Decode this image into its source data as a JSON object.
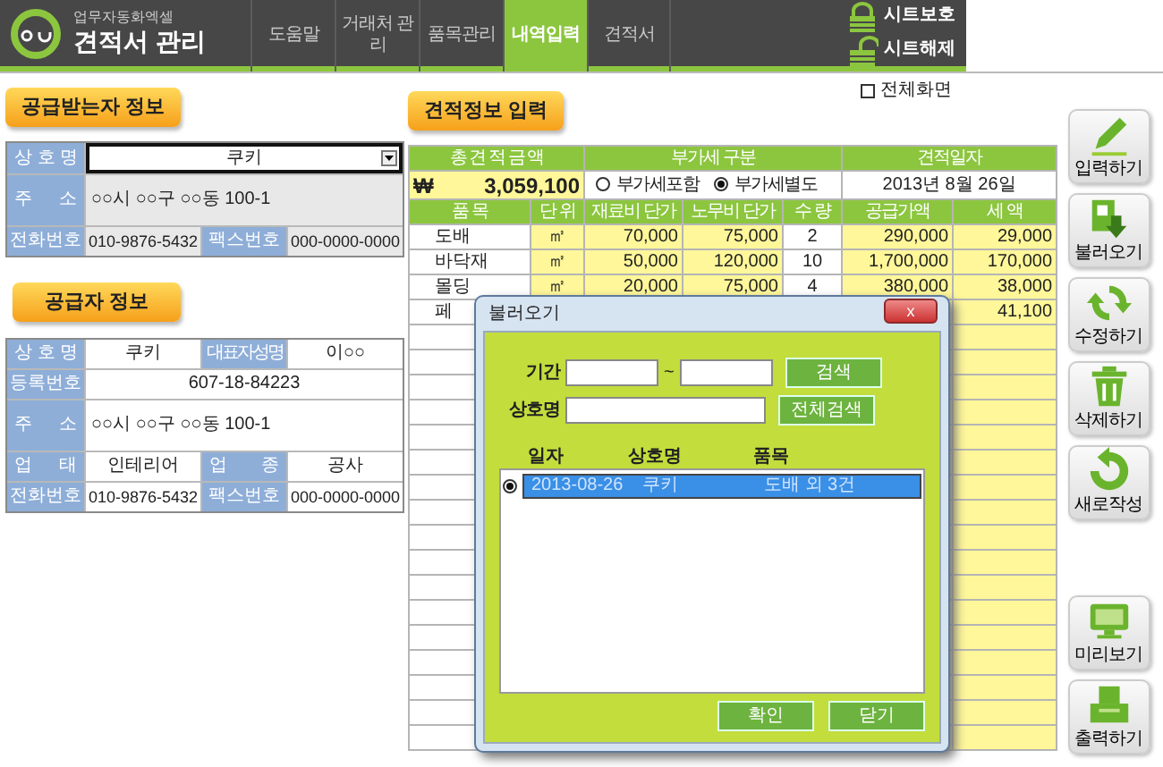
{
  "header": {
    "subtitle": "업무자동화엑셀",
    "title": "견적서 관리",
    "tabs": [
      {
        "label": "도움말",
        "selected": false
      },
      {
        "label": "거래처 관리",
        "selected": false
      },
      {
        "label": "품목관리",
        "selected": false
      },
      {
        "label": "내역입력",
        "selected": true
      },
      {
        "label": "견적서",
        "selected": false
      }
    ],
    "sheet_buttons": [
      {
        "label": "시트보호",
        "kind": "lock"
      },
      {
        "label": "시트해제",
        "kind": "unlock"
      }
    ]
  },
  "fullscreen": {
    "label": "전체화면",
    "checked": false
  },
  "recipient": {
    "title": "공급받는자 정보",
    "company_label": "상 호 명",
    "company": "쿠키",
    "address_label": "주 소",
    "address": "○○시 ○○구 ○○동 100-1",
    "phone_label": "전화번호",
    "phone": "010-9876-5432",
    "fax_label": "팩스번호",
    "fax": "000-0000-0000"
  },
  "supplier": {
    "title": "공급자 정보",
    "company_label": "상 호 명",
    "company": "쿠키",
    "rep_label": "대표자성명",
    "rep": "이○○",
    "reg_label": "등록번호",
    "reg": "607-18-84223",
    "address_label": "주 소",
    "address": "○○시 ○○구 ○○동 100-1",
    "business_label": "업 태",
    "business": "인테리어",
    "category_label": "업 종",
    "category": "공사",
    "phone_label": "전화번호",
    "phone": "010-9876-5432",
    "fax_label": "팩스번호",
    "fax": "000-0000-0000"
  },
  "quote": {
    "title": "견적정보 입력",
    "total_label": "총 견 적 금 액",
    "currency": "₩",
    "total": "3,059,100",
    "vat_label": "부가세 구분",
    "vat_options": [
      {
        "label": "부가세포함",
        "selected": false
      },
      {
        "label": "부가세별도",
        "selected": true
      }
    ],
    "date_label": "견적일자",
    "date": "2013년 8월 26일",
    "columns": [
      "품 목",
      "단 위",
      "재료비 단가",
      "노무비 단가",
      "수 량",
      "공급가액",
      "세 액"
    ],
    "rows": [
      {
        "item": "도배",
        "unit": "㎡",
        "material": "70,000",
        "labor": "75,000",
        "qty": "2",
        "supply": "290,000",
        "tax": "29,000"
      },
      {
        "item": "바닥재",
        "unit": "㎡",
        "material": "50,000",
        "labor": "120,000",
        "qty": "10",
        "supply": "1,700,000",
        "tax": "170,000"
      },
      {
        "item": "몰딩",
        "unit": "㎡",
        "material": "20,000",
        "labor": "75,000",
        "qty": "4",
        "supply": "380,000",
        "tax": "38,000"
      },
      {
        "item": "페",
        "tax": "41,100"
      }
    ]
  },
  "dialog": {
    "title": "불러오기",
    "close": "x",
    "period_label": "기간",
    "period_sep": "~",
    "company_label": "상호명",
    "search": "검색",
    "search_all": "전체검색",
    "list_columns": [
      "일자",
      "상호명",
      "품목"
    ],
    "list_rows": [
      {
        "date": "2013-08-26",
        "company": "쿠키",
        "items": "도배 외 3건",
        "selected": true
      }
    ],
    "buttons": [
      "확인",
      "닫기"
    ]
  },
  "actions_top": [
    {
      "label": "입력하기",
      "kind": "pencil"
    },
    {
      "label": "불러오기",
      "kind": "import"
    },
    {
      "label": "수정하기",
      "kind": "refresh"
    },
    {
      "label": "삭제하기",
      "kind": "trash"
    },
    {
      "label": "새로작성",
      "kind": "undo"
    }
  ],
  "actions_bottom": [
    {
      "label": "미리보기",
      "kind": "monitor"
    },
    {
      "label": "출력하기",
      "kind": "printer"
    }
  ]
}
